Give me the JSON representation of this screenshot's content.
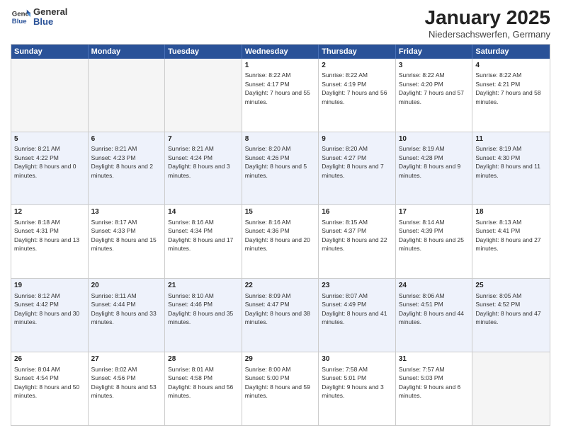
{
  "logo": {
    "general": "General",
    "blue": "Blue"
  },
  "header": {
    "title": "January 2025",
    "subtitle": "Niedersachswerfen, Germany"
  },
  "days": [
    "Sunday",
    "Monday",
    "Tuesday",
    "Wednesday",
    "Thursday",
    "Friday",
    "Saturday"
  ],
  "rows": [
    [
      {
        "day": "",
        "content": "",
        "empty": true
      },
      {
        "day": "",
        "content": "",
        "empty": true
      },
      {
        "day": "",
        "content": "",
        "empty": true
      },
      {
        "day": "1",
        "content": "Sunrise: 8:22 AM\nSunset: 4:17 PM\nDaylight: 7 hours and 55 minutes."
      },
      {
        "day": "2",
        "content": "Sunrise: 8:22 AM\nSunset: 4:19 PM\nDaylight: 7 hours and 56 minutes."
      },
      {
        "day": "3",
        "content": "Sunrise: 8:22 AM\nSunset: 4:20 PM\nDaylight: 7 hours and 57 minutes."
      },
      {
        "day": "4",
        "content": "Sunrise: 8:22 AM\nSunset: 4:21 PM\nDaylight: 7 hours and 58 minutes."
      }
    ],
    [
      {
        "day": "5",
        "content": "Sunrise: 8:21 AM\nSunset: 4:22 PM\nDaylight: 8 hours and 0 minutes."
      },
      {
        "day": "6",
        "content": "Sunrise: 8:21 AM\nSunset: 4:23 PM\nDaylight: 8 hours and 2 minutes."
      },
      {
        "day": "7",
        "content": "Sunrise: 8:21 AM\nSunset: 4:24 PM\nDaylight: 8 hours and 3 minutes."
      },
      {
        "day": "8",
        "content": "Sunrise: 8:20 AM\nSunset: 4:26 PM\nDaylight: 8 hours and 5 minutes."
      },
      {
        "day": "9",
        "content": "Sunrise: 8:20 AM\nSunset: 4:27 PM\nDaylight: 8 hours and 7 minutes."
      },
      {
        "day": "10",
        "content": "Sunrise: 8:19 AM\nSunset: 4:28 PM\nDaylight: 8 hours and 9 minutes."
      },
      {
        "day": "11",
        "content": "Sunrise: 8:19 AM\nSunset: 4:30 PM\nDaylight: 8 hours and 11 minutes."
      }
    ],
    [
      {
        "day": "12",
        "content": "Sunrise: 8:18 AM\nSunset: 4:31 PM\nDaylight: 8 hours and 13 minutes."
      },
      {
        "day": "13",
        "content": "Sunrise: 8:17 AM\nSunset: 4:33 PM\nDaylight: 8 hours and 15 minutes."
      },
      {
        "day": "14",
        "content": "Sunrise: 8:16 AM\nSunset: 4:34 PM\nDaylight: 8 hours and 17 minutes."
      },
      {
        "day": "15",
        "content": "Sunrise: 8:16 AM\nSunset: 4:36 PM\nDaylight: 8 hours and 20 minutes."
      },
      {
        "day": "16",
        "content": "Sunrise: 8:15 AM\nSunset: 4:37 PM\nDaylight: 8 hours and 22 minutes."
      },
      {
        "day": "17",
        "content": "Sunrise: 8:14 AM\nSunset: 4:39 PM\nDaylight: 8 hours and 25 minutes."
      },
      {
        "day": "18",
        "content": "Sunrise: 8:13 AM\nSunset: 4:41 PM\nDaylight: 8 hours and 27 minutes."
      }
    ],
    [
      {
        "day": "19",
        "content": "Sunrise: 8:12 AM\nSunset: 4:42 PM\nDaylight: 8 hours and 30 minutes."
      },
      {
        "day": "20",
        "content": "Sunrise: 8:11 AM\nSunset: 4:44 PM\nDaylight: 8 hours and 33 minutes."
      },
      {
        "day": "21",
        "content": "Sunrise: 8:10 AM\nSunset: 4:46 PM\nDaylight: 8 hours and 35 minutes."
      },
      {
        "day": "22",
        "content": "Sunrise: 8:09 AM\nSunset: 4:47 PM\nDaylight: 8 hours and 38 minutes."
      },
      {
        "day": "23",
        "content": "Sunrise: 8:07 AM\nSunset: 4:49 PM\nDaylight: 8 hours and 41 minutes."
      },
      {
        "day": "24",
        "content": "Sunrise: 8:06 AM\nSunset: 4:51 PM\nDaylight: 8 hours and 44 minutes."
      },
      {
        "day": "25",
        "content": "Sunrise: 8:05 AM\nSunset: 4:52 PM\nDaylight: 8 hours and 47 minutes."
      }
    ],
    [
      {
        "day": "26",
        "content": "Sunrise: 8:04 AM\nSunset: 4:54 PM\nDaylight: 8 hours and 50 minutes."
      },
      {
        "day": "27",
        "content": "Sunrise: 8:02 AM\nSunset: 4:56 PM\nDaylight: 8 hours and 53 minutes."
      },
      {
        "day": "28",
        "content": "Sunrise: 8:01 AM\nSunset: 4:58 PM\nDaylight: 8 hours and 56 minutes."
      },
      {
        "day": "29",
        "content": "Sunrise: 8:00 AM\nSunset: 5:00 PM\nDaylight: 8 hours and 59 minutes."
      },
      {
        "day": "30",
        "content": "Sunrise: 7:58 AM\nSunset: 5:01 PM\nDaylight: 9 hours and 3 minutes."
      },
      {
        "day": "31",
        "content": "Sunrise: 7:57 AM\nSunset: 5:03 PM\nDaylight: 9 hours and 6 minutes."
      },
      {
        "day": "",
        "content": "",
        "empty": true
      }
    ]
  ],
  "altRows": [
    1,
    3
  ]
}
